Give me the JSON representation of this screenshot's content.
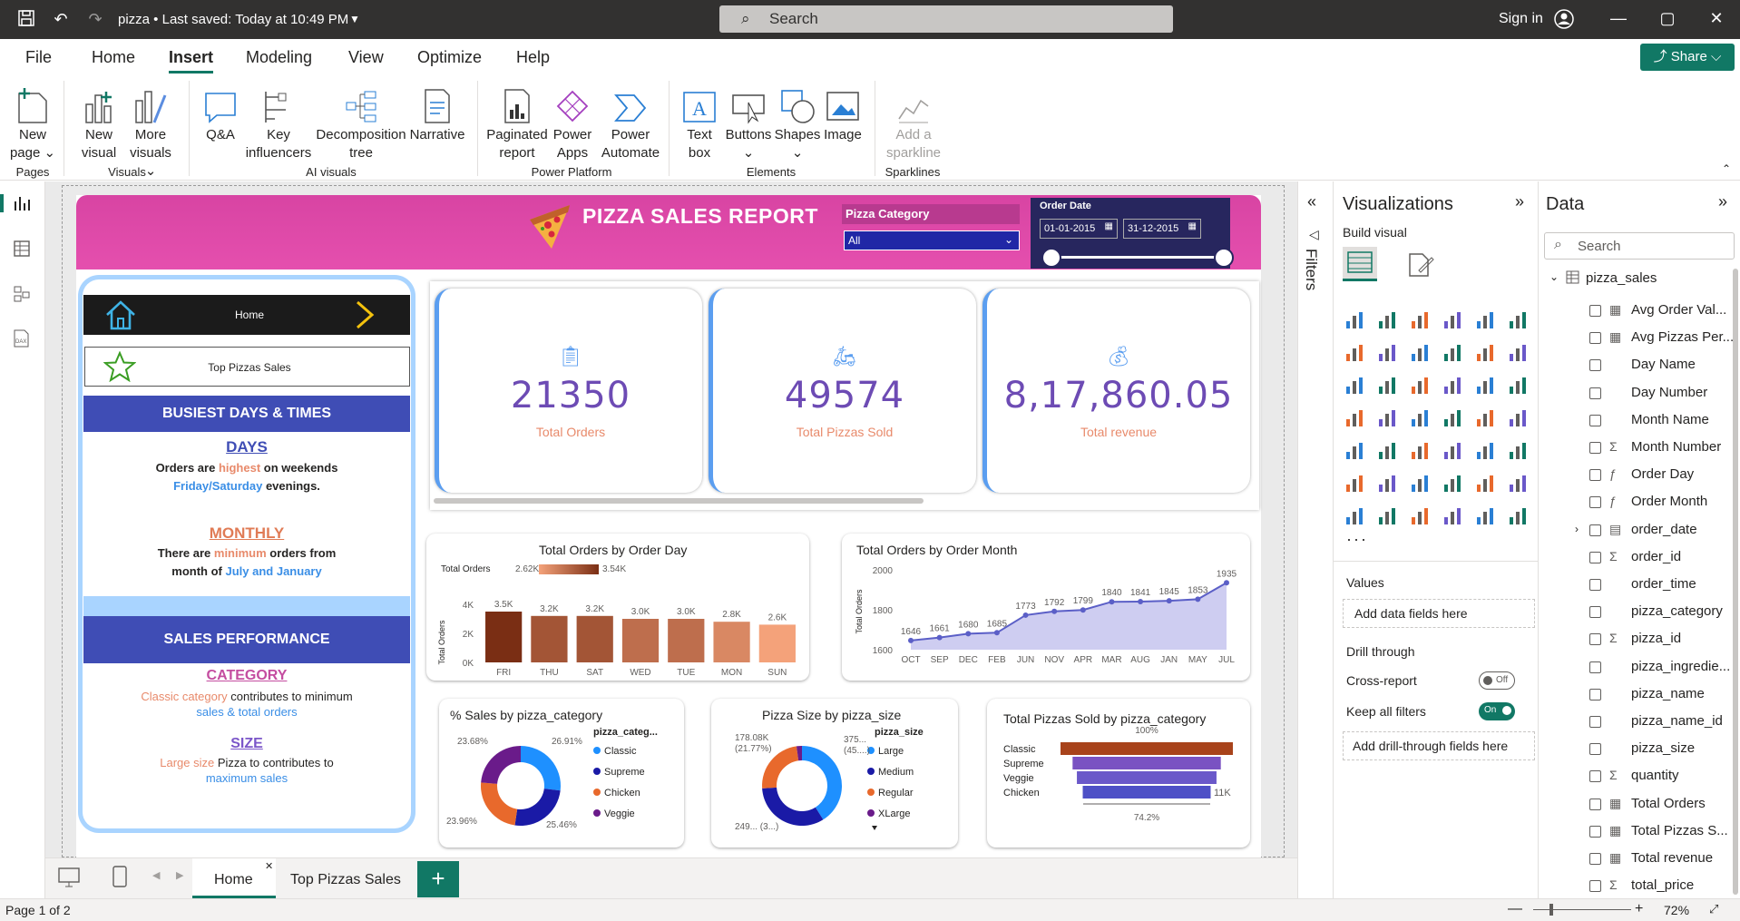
{
  "titlebar": {
    "title": "pizza • Last saved: Today at 10:49 PM",
    "search_placeholder": "Search",
    "signin": "Sign in"
  },
  "menu": {
    "items": [
      "File",
      "Home",
      "Insert",
      "Modeling",
      "View",
      "Optimize",
      "Help"
    ],
    "active": "Insert",
    "share": "Share"
  },
  "ribbon": {
    "buttons": {
      "new_page": [
        "New",
        "page"
      ],
      "new_visual": [
        "New",
        "visual"
      ],
      "more_visuals": [
        "More",
        "visuals"
      ],
      "qa": "Q&A",
      "key_influencers": [
        "Key",
        "influencers"
      ],
      "decomposition_tree": [
        "Decomposition",
        "tree"
      ],
      "narrative": "Narrative",
      "paginated_report": [
        "Paginated",
        "report"
      ],
      "power_apps": [
        "Power",
        "Apps"
      ],
      "power_automate": [
        "Power",
        "Automate"
      ],
      "text_box": [
        "Text",
        "box"
      ],
      "buttons": "Buttons",
      "shapes": "Shapes",
      "image": "Image",
      "add_sparkline": [
        "Add a",
        "sparkline"
      ]
    },
    "groups": {
      "pages": "Pages",
      "visuals": "Visuals",
      "ai_visuals": "AI visuals",
      "power_platform": "Power Platform",
      "elements": "Elements",
      "sparklines": "Sparklines"
    }
  },
  "report": {
    "title": "PIZZA SALES REPORT",
    "slicer_category": {
      "label": "Pizza Category",
      "value": "All"
    },
    "slicer_date": {
      "label": "Order Date",
      "start": "01-01-2015",
      "end": "31-12-2015"
    },
    "nav": {
      "home": "Home",
      "top_pizzas": "Top Pizzas Sales"
    },
    "busiest": {
      "header": "BUSIEST DAYS & TIMES",
      "days_title": "DAYS",
      "days_line1_a": "Orders are ",
      "days_line1_b": "highest",
      "days_line1_c": " on weekends",
      "days_line2_a": "Friday/Saturday",
      "days_line2_b": " evenings.",
      "monthly_title": "MONTHLY",
      "monthly_line1_a": "There are ",
      "monthly_line1_b": "minimum",
      "monthly_line1_c": " orders from",
      "monthly_line2_a": "month of ",
      "monthly_line2_b": "July and January"
    },
    "sales_perf": {
      "header": "SALES PERFORMANCE",
      "category_title": "CATEGORY",
      "category_line1_a": "Classic category",
      "category_line1_b": " contributes to minimum",
      "category_line2": "sales & total orders",
      "size_title": "SIZE",
      "size_line1_a": "Large size",
      "size_line1_b": " Pizza to contributes to",
      "size_line2": "maximum sales"
    },
    "kpis": [
      {
        "value": "21350",
        "label": "Total Orders"
      },
      {
        "value": "49574",
        "label": "Total Pizzas Sold"
      },
      {
        "value": "8,17,860.05",
        "label": "Total revenue"
      }
    ],
    "colors": {
      "header": "#dc48a8",
      "kpi_value": "#6d4bb4",
      "accent_blue": "#3f4db5",
      "pbi_green": "#117865"
    }
  },
  "chart_data": [
    {
      "type": "bar",
      "title": "Total Orders by Order Day",
      "categories": [
        "FRI",
        "THU",
        "SAT",
        "WED",
        "TUE",
        "MON",
        "SUN"
      ],
      "values": [
        3500,
        3200,
        3200,
        3000,
        3000,
        2800,
        2600
      ],
      "data_labels": [
        "3.5K",
        "3.2K",
        "3.2K",
        "3.0K",
        "3.0K",
        "2.8K",
        "2.6K"
      ],
      "ylabel": "Total Orders",
      "yticks": [
        "0K",
        "2K",
        "4K"
      ],
      "ylim": [
        0,
        4000
      ],
      "legend": {
        "title": "Total Orders",
        "min": "2.62K",
        "max": "3.54K"
      }
    },
    {
      "type": "area",
      "title": "Total Orders by Order Month",
      "categories": [
        "OCT",
        "SEP",
        "DEC",
        "FEB",
        "JUN",
        "NOV",
        "APR",
        "MAR",
        "AUG",
        "JAN",
        "MAY",
        "JUL"
      ],
      "values": [
        1646,
        1661,
        1680,
        1685,
        1773,
        1792,
        1799,
        1840,
        1841,
        1845,
        1853,
        1935
      ],
      "ylabel": "Total Orders",
      "yticks": [
        "1600",
        "1800",
        "2000"
      ],
      "ylim": [
        1600,
        2000
      ]
    },
    {
      "type": "pie",
      "title": "% Sales by pizza_category",
      "legend_title": "pizza_categ...",
      "series": [
        {
          "name": "Classic",
          "value": 26.91,
          "label": "26.91%",
          "color": "#1e90ff"
        },
        {
          "name": "Supreme",
          "value": 25.46,
          "label": "25.46%",
          "color": "#1a1aa6"
        },
        {
          "name": "Chicken",
          "value": 23.96,
          "label": "23.96%",
          "color": "#e8692c"
        },
        {
          "name": "Veggie",
          "value": 23.68,
          "label": "23.68%",
          "color": "#6a1b8a"
        }
      ]
    },
    {
      "type": "pie",
      "title": "Pizza Size by pizza_size",
      "legend_title": "pizza_size",
      "series": [
        {
          "name": "Large",
          "value": 37.5,
          "label": "375... (45....)",
          "color": "#1e90ff"
        },
        {
          "name": "Medium",
          "value": 30.0,
          "label": "249... (3...)",
          "color": "#1a1aa6"
        },
        {
          "name": "Regular",
          "value": 21.77,
          "label": "178.08K (21.77%)",
          "color": "#e8692c"
        },
        {
          "name": "XLarge",
          "value": 2.0,
          "label": "",
          "color": "#6a1b8a"
        }
      ]
    },
    {
      "type": "bar",
      "title": "Total Pizzas Sold by pizza_category",
      "categories": [
        "Classic",
        "Supreme",
        "Veggie",
        "Chicken"
      ],
      "values": [
        100,
        86,
        81,
        74.2
      ],
      "top_label": "100%",
      "bottom_label": "74.2%",
      "end_label": "11K"
    }
  ],
  "panes": {
    "filters": "Filters",
    "visualizations": "Visualizations",
    "build_visual": "Build visual",
    "values": "Values",
    "add_data_fields": "Add data fields here",
    "drill_through": "Drill through",
    "cross_report": "Cross-report",
    "cross_report_state": "Off",
    "keep_all_filters": "Keep all filters",
    "keep_all_filters_state": "On",
    "add_drill_fields": "Add drill-through fields here",
    "data": "Data",
    "data_search": "Search",
    "table_name": "pizza_sales",
    "fields": [
      {
        "name": "Avg Order Val...",
        "sym": "calc"
      },
      {
        "name": "Avg Pizzas Per...",
        "sym": "calc"
      },
      {
        "name": "Day Name",
        "sym": ""
      },
      {
        "name": "Day Number",
        "sym": ""
      },
      {
        "name": "Month Name",
        "sym": ""
      },
      {
        "name": "Month Number",
        "sym": "sigma"
      },
      {
        "name": "Order Day",
        "sym": "fx"
      },
      {
        "name": "Order Month",
        "sym": "fx"
      },
      {
        "name": "order_date",
        "sym": "table"
      },
      {
        "name": "order_id",
        "sym": "sigma"
      },
      {
        "name": "order_time",
        "sym": ""
      },
      {
        "name": "pizza_category",
        "sym": ""
      },
      {
        "name": "pizza_id",
        "sym": "sigma"
      },
      {
        "name": "pizza_ingredie...",
        "sym": ""
      },
      {
        "name": "pizza_name",
        "sym": ""
      },
      {
        "name": "pizza_name_id",
        "sym": ""
      },
      {
        "name": "pizza_size",
        "sym": ""
      },
      {
        "name": "quantity",
        "sym": "sigma"
      },
      {
        "name": "Total Orders",
        "sym": "calc"
      },
      {
        "name": "Total Pizzas S...",
        "sym": "calc"
      },
      {
        "name": "Total revenue",
        "sym": "calc"
      },
      {
        "name": "total_price",
        "sym": "sigma"
      }
    ]
  },
  "tabs": {
    "items": [
      "Home",
      "Top Pizzas Sales"
    ],
    "active": "Home"
  },
  "status": {
    "page": "Page 1 of 2",
    "zoom": "72%"
  }
}
